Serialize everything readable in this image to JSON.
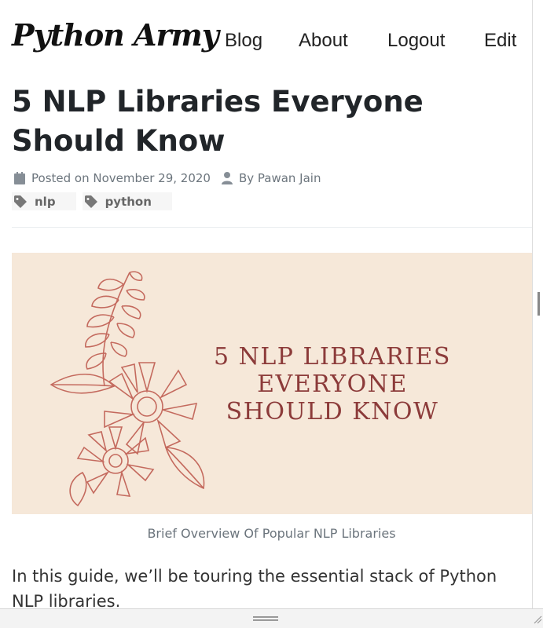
{
  "header": {
    "brand": "Python Army",
    "nav": [
      "Blog",
      "About",
      "Logout",
      "Edit"
    ]
  },
  "post": {
    "title": "5 NLP Libraries Everyone Should Know",
    "posted_on": "Posted on November 29, 2020",
    "author": "By Pawan Jain",
    "tags": [
      "nlp",
      "python"
    ],
    "hero_text": "5 NLP LIBRARIES EVERYONE SHOULD KNOW",
    "caption": "Brief Overview Of Popular NLP Libraries",
    "intro": "In this guide, we’ll be touring the essential stack of Python NLP libraries."
  },
  "icons": [
    "calendar-icon",
    "user-icon",
    "tag-icon"
  ],
  "colors": {
    "hero_background": "#f6e8d9",
    "hero_text": "#8c3b3a",
    "illustration": "#c46a5e",
    "meta_text": "#6c757d"
  }
}
